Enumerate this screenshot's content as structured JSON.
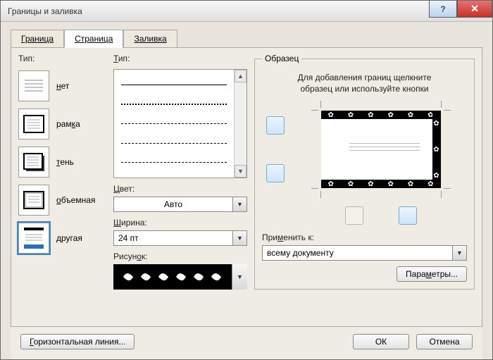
{
  "window": {
    "title": "Границы и заливка"
  },
  "tabs": {
    "border": "Граница",
    "page": "Страница",
    "fill": "Заливка"
  },
  "col1": {
    "label": "Тип:",
    "items": {
      "none": {
        "label": "нет",
        "ul": "н"
      },
      "box": {
        "label": "рамка",
        "ul": "к"
      },
      "shadow": {
        "label": "тень",
        "ul": "т"
      },
      "threeD": {
        "label": "объемная",
        "ul": "о"
      },
      "custom": {
        "label": "другая",
        "ul": "д"
      }
    }
  },
  "col2": {
    "style_label": "Тип:",
    "color_label": "Цвет:",
    "color_value": "Авто",
    "width_label": "Ширина:",
    "width_value": "24 пт",
    "art_label": "Рисунок:"
  },
  "col3": {
    "legend": "Образец",
    "hint_line1": "Для добавления границ щелкните",
    "hint_line2": "образец или используйте кнопки",
    "apply_label": "Применить к:",
    "apply_value": "всему документу",
    "params_btn": "Параметры..."
  },
  "footer": {
    "hr_btn": "Горизонтальная линия...",
    "ok": "ОК",
    "cancel": "Отмена"
  }
}
